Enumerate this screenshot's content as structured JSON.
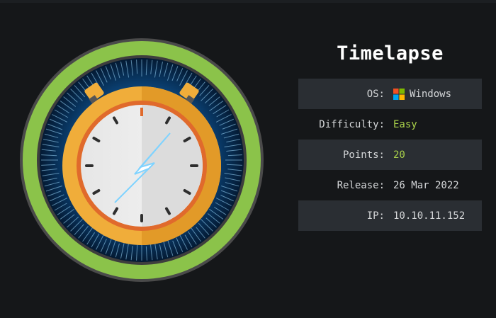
{
  "machine": {
    "name": "Timelapse"
  },
  "info": [
    {
      "label": "OS:",
      "value": "Windows",
      "icon": "windows-icon",
      "shaded": true,
      "accent": false
    },
    {
      "label": "Difficulty:",
      "value": "Easy",
      "shaded": false,
      "accent": true
    },
    {
      "label": "Points:",
      "value": "20",
      "shaded": true,
      "accent": true
    },
    {
      "label": "Release:",
      "value": "26 Mar 2022",
      "shaded": false,
      "accent": false
    },
    {
      "label": "IP:",
      "value": "10.10.11.152",
      "shaded": true,
      "accent": false
    }
  ],
  "colors": {
    "background": "#151719",
    "ring": "#8bc34a",
    "accent_text": "#a9d14a",
    "shaded_row": "#2a2e33",
    "clock_body": "#f0ad3a",
    "clock_rim": "#e06a2c",
    "glow": "#3fa9f5"
  }
}
